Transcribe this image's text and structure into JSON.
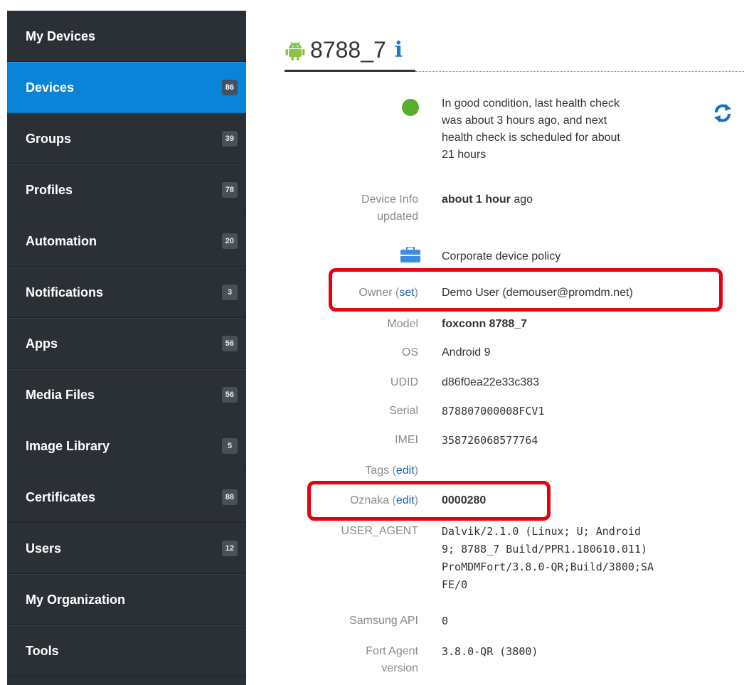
{
  "sidebar": {
    "items": [
      {
        "label": "My Devices",
        "badge": ""
      },
      {
        "label": "Devices",
        "badge": "86"
      },
      {
        "label": "Groups",
        "badge": "39"
      },
      {
        "label": "Profiles",
        "badge": "78"
      },
      {
        "label": "Automation",
        "badge": "20"
      },
      {
        "label": "Notifications",
        "badge": "3"
      },
      {
        "label": "Apps",
        "badge": "56"
      },
      {
        "label": "Media Files",
        "badge": "56"
      },
      {
        "label": "Image Library",
        "badge": "5"
      },
      {
        "label": "Certificates",
        "badge": "88"
      },
      {
        "label": "Users",
        "badge": "12"
      },
      {
        "label": "My Organization",
        "badge": ""
      },
      {
        "label": "Tools",
        "badge": ""
      }
    ],
    "active_index": 1
  },
  "device": {
    "title": "8788_7",
    "info_glyph": "i",
    "health": {
      "line1": "In good condition, last health check",
      "line2": "was about 3 hours ago, and next",
      "line3": "health check is scheduled for about",
      "line4": "21 hours"
    },
    "device_info": {
      "label_line1": "Device Info",
      "label_line2": "updated",
      "value_bold": "about 1 hour",
      "value_rest": " ago"
    },
    "policy": "Corporate device policy",
    "owner": {
      "label": "Owner (",
      "link": "set",
      "label_end": ")",
      "value": "Demo User (demouser@promdm.net)"
    },
    "model": {
      "label": "Model",
      "value": "foxconn 8788_7"
    },
    "os": {
      "label": "OS",
      "value": "Android 9"
    },
    "udid": {
      "label": "UDID",
      "value": "d86f0ea22e33c383"
    },
    "serial": {
      "label": "Serial",
      "value": "878807000008FCV1"
    },
    "imei": {
      "label": "IMEI",
      "value": "358726068577764"
    },
    "tags": {
      "label": "Tags (",
      "link": "edit",
      "label_end": ")"
    },
    "oznaka": {
      "label": "Oznaka (",
      "link": "edit",
      "label_end": ")",
      "value": "0000280"
    },
    "user_agent": {
      "label": "USER_AGENT",
      "line1": "Dalvik/2.1.0 (Linux; U; Android",
      "line2": "9; 8788_7 Build/PPR1.180610.011)",
      "line3": "ProMDMFort/3.8.0-QR;Build/3800;SA",
      "line4": "FE/0"
    },
    "samsung_api": {
      "label": "Samsung API",
      "value": "0"
    },
    "fort_agent": {
      "label_line1": "Fort Agent",
      "label_line2": "version",
      "value": "3.8.0-QR (3800)"
    }
  },
  "colors": {
    "sidebar_bg": "#2b3036",
    "active_bg": "#0a84d9",
    "status_green": "#58ad2c",
    "link_blue": "#1a62b8",
    "highlight_red": "#e8000f"
  },
  "icons": {
    "title_icon": "android-icon",
    "info_icon": "info-icon",
    "status_icon": "status-dot-icon",
    "policy_icon": "briefcase-icon",
    "refresh_icon": "refresh-icon"
  }
}
